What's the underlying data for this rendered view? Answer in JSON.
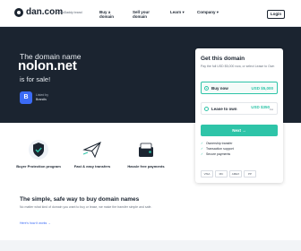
{
  "header": {
    "brand": "dan.com",
    "partner": "a GoDaddy brand",
    "nav": {
      "buy": "Buy a domain",
      "sell": "Sell your domain",
      "learn": "Learn ▾",
      "company": "Company ▾"
    },
    "login_label": "Login"
  },
  "hero": {
    "tagline": "The domain name",
    "domain": "nolon.net",
    "status": "is for sale!",
    "listed_label": "Listed by",
    "listed_name": "Brandis",
    "badge_letter": "B"
  },
  "card": {
    "title": "Get this domain",
    "subtitle": "Pay the full USD $5,000 now, or select Lease to Own",
    "options": [
      {
        "label": "Buy now",
        "price": "USD $5,000",
        "selected": true
      },
      {
        "label": "Lease to own",
        "price": "USD $350",
        "price_note": "/mo",
        "selected": false
      }
    ],
    "next_label": "Next →",
    "perks": [
      "Ownership transfer",
      "Transaction support",
      "Secure payments"
    ],
    "payments": [
      "VISA",
      "MC",
      "AMEX",
      "PP"
    ]
  },
  "features": [
    {
      "icon": "shield-icon",
      "label": "Buyer Protection program"
    },
    {
      "icon": "paper-plane-icon",
      "label": "Fast & easy transfers"
    },
    {
      "icon": "wallet-icon",
      "label": "Hassle free payments"
    }
  ],
  "bottom": {
    "title": "The simple, safe way to buy domain names",
    "text": "No matter what kind of domain you want to buy or lease, we make the transfer simple and safe.",
    "link": "Here's how it works →"
  },
  "colors": {
    "hero_bg": "#1b2430",
    "accent": "#2ec4a8",
    "brand_blue": "#3b6bf5"
  }
}
